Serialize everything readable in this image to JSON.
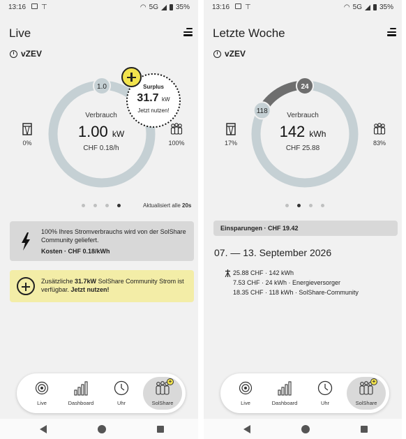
{
  "status": {
    "time": "13:16",
    "network": "5G",
    "battery": "35%"
  },
  "live": {
    "title": "Live",
    "community": "vZEV",
    "ring_top": "1.0",
    "center_label": "Verbrauch",
    "center_value": "1.00",
    "center_unit": "kW",
    "center_cost": "CHF 0.18/h",
    "left_pct": "0%",
    "right_pct": "100%",
    "surplus": {
      "title": "Surplus",
      "value": "31.7",
      "unit": "kW",
      "cta": "Jetzt nutzen!"
    },
    "updated_prefix": "Aktualisiert alle ",
    "updated_value": "20s",
    "info_card": {
      "text": "100% Ihres Stromverbrauchs wird von der SolShare Community geliefert.",
      "cost": "Kosten · CHF 0.18/kWh"
    },
    "promo_card": {
      "pre": "Zusätzliche ",
      "amount": "31.7kW",
      "mid": " SolShare Community Strom ist verfügbar. ",
      "cta": "Jetzt nutzen!"
    }
  },
  "week": {
    "title": "Letzte Woche",
    "community": "vZEV",
    "ring_top": "24",
    "ring_left": "118",
    "center_label": "Verbrauch",
    "center_value": "142",
    "center_unit": "kWh",
    "center_cost": "CHF 25.88",
    "left_pct": "17%",
    "right_pct": "83%",
    "grid_share": 0.17,
    "savings": "Einsparungen · CHF 19.42",
    "daterange": "07. — 13. September 2026",
    "entries": [
      "25.88 CHF · 142 kWh",
      "7.53 CHF · 24 kWh · Energieversorger",
      "18.35 CHF · 118 kWh · SolShare-Community"
    ]
  },
  "nav": {
    "live": "Live",
    "dashboard": "Dashboard",
    "clock": "Uhr",
    "solshare": "SolShare"
  },
  "colors": {
    "ring": "#c5d0d4",
    "ring_dark": "#6e6e6e",
    "yellow": "#f2e34d",
    "card_grey": "#d8d8d8",
    "card_yellow": "#f3eda7"
  }
}
